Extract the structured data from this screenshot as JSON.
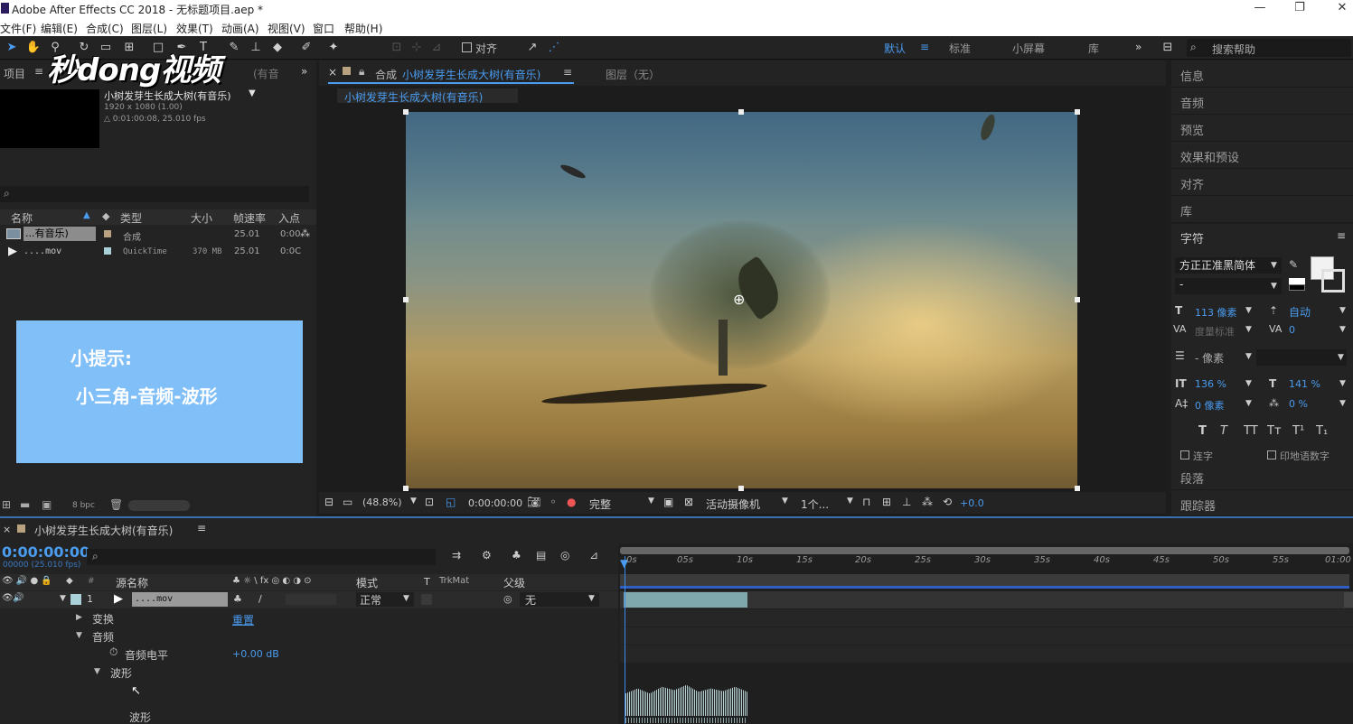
{
  "window": {
    "title": "Adobe After Effects CC 2018 - 无标题项目.aep *",
    "minimize": "—",
    "maximize": "❐",
    "close": "✕"
  },
  "menu": [
    "文件(F)",
    "编辑(E)",
    "合成(C)",
    "图层(L)",
    "效果(T)",
    "动画(A)",
    "视图(V)",
    "窗口",
    "帮助(H)"
  ],
  "toolbar": {
    "align_label": "对齐",
    "workspaces": [
      "默认",
      "标准",
      "小屏幕",
      "库"
    ],
    "search_placeholder": "搜索帮助"
  },
  "watermark": "秒dong视频",
  "project": {
    "tab_label": "项目",
    "tab_trailing": "(有音",
    "comp_name": "小树发芽生长成大树(有音乐)",
    "comp_info1": "1920 x 1080 (1.00)",
    "comp_info2": "△ 0:01:00:08, 25.010 fps",
    "search_icon": "⌕",
    "columns": [
      "名称",
      "类型",
      "大小",
      "帧速率",
      "入点"
    ],
    "rows": [
      {
        "name": "...有音乐)",
        "type": "合成",
        "size": "",
        "fps": "25.01",
        "in": "0:00"
      },
      {
        "name": "....mov",
        "type": "QuickTime",
        "size": "370 MB",
        "fps": "25.01",
        "in": "0:0C"
      }
    ],
    "bpc": "8 bpc"
  },
  "tip": {
    "line1": "小提示:",
    "line2": "小三角-音频-波形"
  },
  "composition": {
    "tab_label": "合成",
    "tab_name": "小树发芽生长成大树(有音乐)",
    "layer_tab": "图层（无）",
    "breadcrumb": "小树发芽生长成大树(有音乐)",
    "zoom": "(48.8%)",
    "timecode": "0:00:00:00",
    "quality": "完整",
    "camera": "活动摄像机",
    "views": "1个...",
    "exposure": "+0.0"
  },
  "right_panels": [
    "信息",
    "音频",
    "预览",
    "效果和预设",
    "对齐",
    "库"
  ],
  "character": {
    "title": "字符",
    "font": "方正正准黑简体",
    "style": "-",
    "size": "113 像素",
    "leading": "自动",
    "kerning": "度量标准",
    "tracking": "0",
    "stroke": "- 像素",
    "vscale": "136 %",
    "hscale": "141 %",
    "baseline": "0 像素",
    "tsume": "0 %",
    "styles": [
      "T",
      "T",
      "TT",
      "Tт",
      "T¹",
      "T₁"
    ],
    "opt1": "连字",
    "opt2": "印地语数字"
  },
  "bottom_right_panels": [
    "段落",
    "跟踪器"
  ],
  "timeline": {
    "tab_name": "小树发芽生长成大树(有音乐)",
    "timecode": "0:00:00:00",
    "frame_info": "00000 (25.010 fps)",
    "columns": {
      "name": "源名称",
      "mode": "模式",
      "t": "T",
      "trkmat": "TrkMat",
      "parent": "父级"
    },
    "ticks": [
      "0s",
      "05s",
      "10s",
      "15s",
      "20s",
      "25s",
      "30s",
      "35s",
      "40s",
      "45s",
      "50s",
      "55s",
      "01:00"
    ],
    "layer": {
      "index": "1",
      "name": "....mov",
      "mode": "正常",
      "parent": "无"
    },
    "props": {
      "transform": "变换",
      "transform_value": "重置",
      "audio": "音频",
      "audio_level": "音频电平",
      "audio_level_value": "+0.00 dB",
      "waveform_group": "波形",
      "waveform": "波形"
    }
  }
}
